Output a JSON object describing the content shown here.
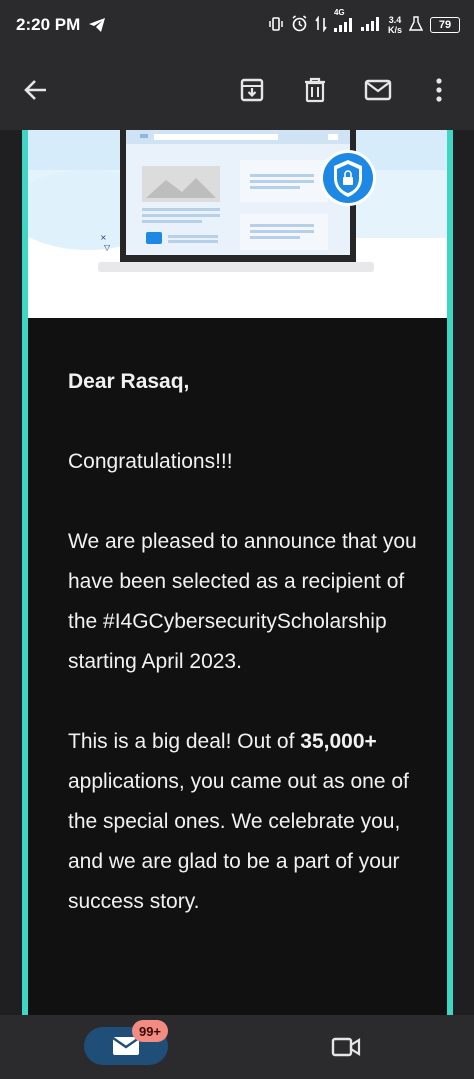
{
  "statusbar": {
    "time": "2:20 PM",
    "network": "4G",
    "speed_value": "3.4",
    "speed_unit": "K/s",
    "battery": "79"
  },
  "email": {
    "greeting": "Dear Rasaq,",
    "congrats": "Congratulations!!!",
    "paragraph1": "We are pleased to announce that you have been selected as a recipient of the #I4GCybersecurityScholarship starting April 2023.",
    "paragraph2_start": "This is a big deal! Out of ",
    "paragraph2_bold": "35,000+",
    "paragraph2_end": " applications, you came out as one of the special ones. We celebrate you, and we are glad to be a part of your success story."
  },
  "bottomnav": {
    "mail_badge": "99+"
  },
  "colors": {
    "accent": "#3fd6c6",
    "appbar": "#2b2b2d",
    "card_bg": "#111112",
    "badge": "#f28b82",
    "mail_pill": "#1f4e79"
  }
}
